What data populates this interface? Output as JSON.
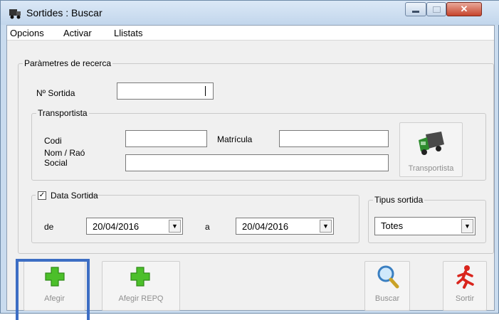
{
  "window": {
    "title": "Sortides : Buscar"
  },
  "menu": [
    "Opcions",
    "Activar",
    "Llistats"
  ],
  "params": {
    "legend": "Paràmetres de recerca",
    "nsortida_label": "Nº Sortida",
    "nsortida_value": ""
  },
  "transportista": {
    "legend": "Transportista",
    "codi_label": "Codi",
    "codi_value": "",
    "matricula_label": "Matrícula",
    "matricula_value": "",
    "nom_label_line1": "Nom / Raó",
    "nom_label_line2": "Social",
    "nom_value": "",
    "button_label": "Transportista",
    "button_icon": "truck-icon"
  },
  "data_sortida": {
    "label": "Data Sortida",
    "checked": true,
    "de_label": "de",
    "de_value": "20/04/2016",
    "a_label": "a",
    "a_value": "20/04/2016"
  },
  "tipus": {
    "legend": "Tipus sortida",
    "value": "Totes"
  },
  "toolbar": {
    "afegir": "Afegir",
    "afegir_repq": "Afegir REPQ",
    "buscar": "Buscar",
    "sortir": "Sortir"
  },
  "colors": {
    "highlight": "#3d6ec4",
    "add_green": "#4cbf2a",
    "exit_red": "#d9251d"
  }
}
